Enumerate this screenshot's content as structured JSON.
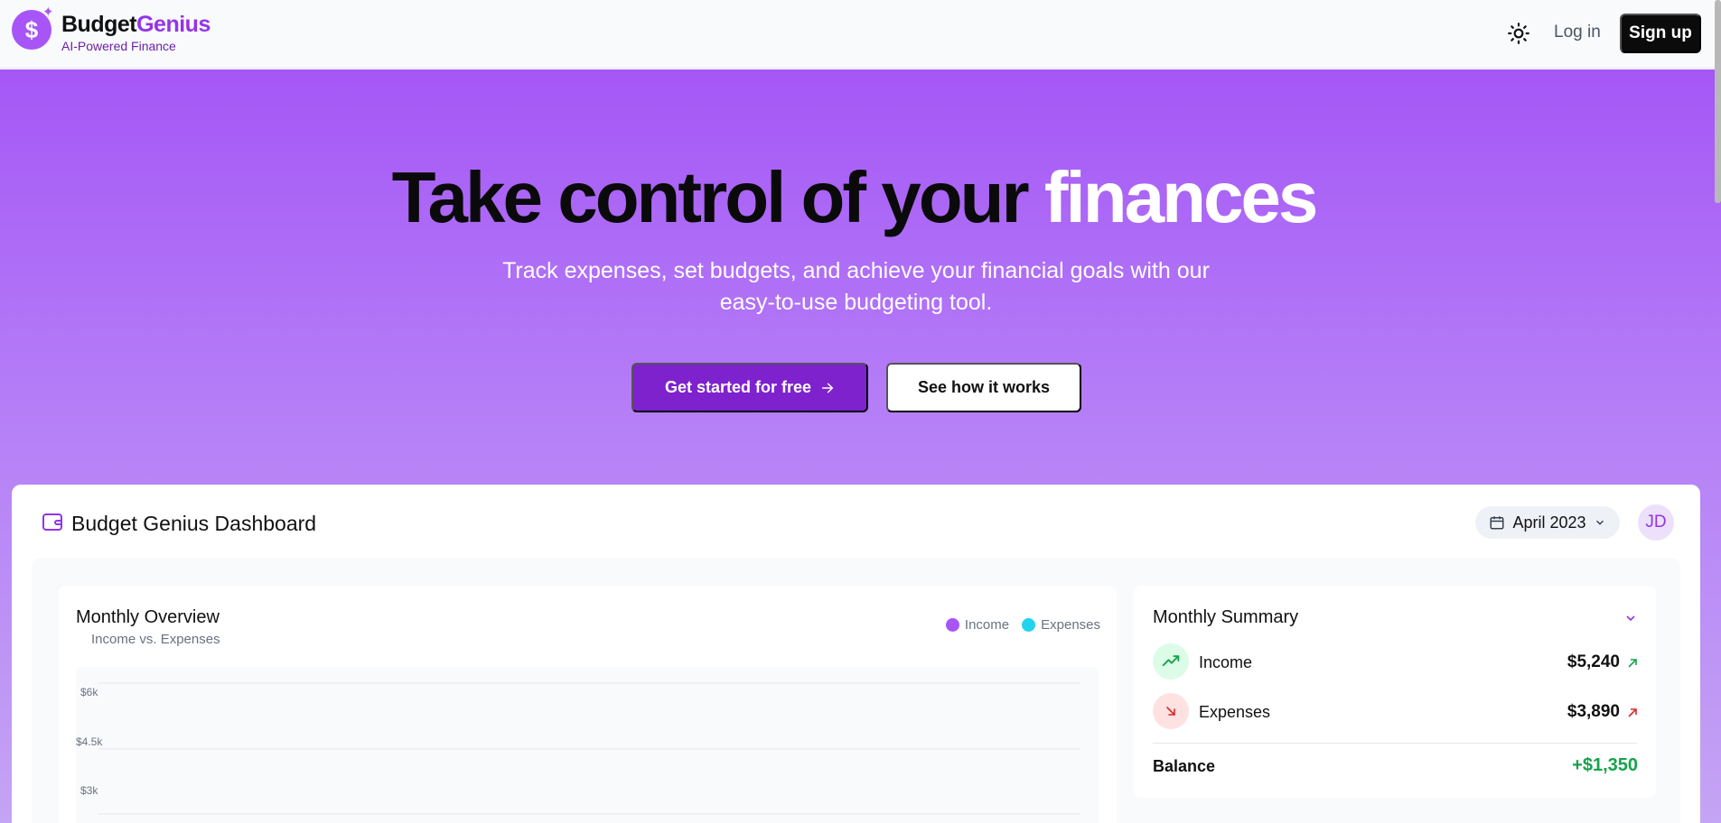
{
  "nav": {
    "brand_part1": "Budget",
    "brand_part2": "Genius",
    "tagline": "AI-Powered Finance",
    "login_label": "Log in",
    "signup_label": "Sign up"
  },
  "hero": {
    "title_dark": "Take control of your",
    "title_light": "finances",
    "subtitle": "Track expenses, set budgets, and achieve your financial goals with our easy-to-use budgeting tool.",
    "primary_cta": "Get started for free",
    "secondary_cta": "See how it works"
  },
  "dashboard": {
    "title": "Budget Genius Dashboard",
    "month": "April 2023",
    "avatar_initials": "JD",
    "overview": {
      "title": "Monthly Overview",
      "subtitle": "Income vs. Expenses",
      "legend_income": "Income",
      "legend_expenses": "Expenses",
      "y_ticks": [
        "$6k",
        "$4.5k",
        "$3k"
      ]
    },
    "summary": {
      "title": "Monthly Summary",
      "income_label": "Income",
      "income_value": "$5,240",
      "expenses_label": "Expenses",
      "expenses_value": "$3,890",
      "balance_label": "Balance",
      "balance_value": "+$1,350"
    }
  },
  "colors": {
    "brand_purple": "#9333ea",
    "income": "#a855f7",
    "expenses": "#22d3ee",
    "positive": "#16a34a",
    "negative": "#dc2626"
  }
}
